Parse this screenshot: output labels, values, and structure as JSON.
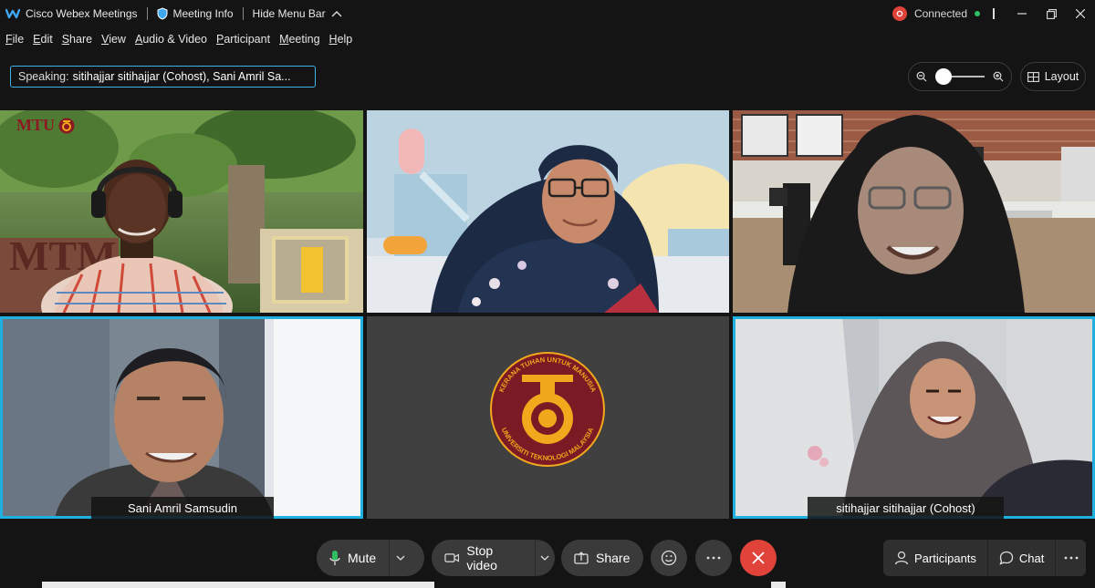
{
  "titlebar": {
    "app_name": "Cisco Webex Meetings",
    "meeting_info": "Meeting Info",
    "hide_menu": "Hide Menu Bar",
    "connection_status": "Connected"
  },
  "menu": {
    "items": [
      "File",
      "Edit",
      "Share",
      "View",
      "Audio & Video",
      "Participant",
      "Meeting",
      "Help"
    ],
    "mnemonics": [
      "F",
      "E",
      "S",
      "V",
      "A",
      "P",
      "M",
      "H"
    ]
  },
  "speaking": {
    "label": "Speaking:",
    "names": "sitihajjar sitihajjar (Cohost), Sani Amril Sa..."
  },
  "toolbar": {
    "layout_label": "Layout"
  },
  "tiles": {
    "tile1": {
      "logo": "MTU"
    },
    "tile5": {
      "logo_text_top": "KERANA TUHAN UNTUK MANUSIA",
      "logo_text_bottom": "UNIVERSITI TEKNOLOGI MALAYSIA"
    },
    "sani": {
      "name": "Sani Amril Samsudin"
    },
    "siti": {
      "name": "sitihajjar sitihajjar  (Cohost)"
    }
  },
  "controls": {
    "mute_label": "Mute",
    "stop_video_label": "Stop video",
    "share_label": "Share",
    "participants_label": "Participants",
    "chat_label": "Chat"
  },
  "colors": {
    "accent": "#1fb0e0",
    "end_call": "#e0433a",
    "connected": "#2fbf62",
    "utm_maroon": "#7a1a24",
    "utm_gold": "#f2a81d"
  },
  "icons": [
    "webex-logo-icon",
    "shield-icon",
    "chevron-up-icon",
    "record-icon",
    "minimize-icon",
    "restore-icon",
    "close-icon",
    "zoom-out-icon",
    "zoom-in-icon",
    "layout-grid-icon",
    "microphone-icon",
    "camera-icon",
    "share-screen-icon",
    "reactions-icon",
    "more-icon",
    "end-call-icon",
    "participants-icon",
    "chat-icon"
  ]
}
